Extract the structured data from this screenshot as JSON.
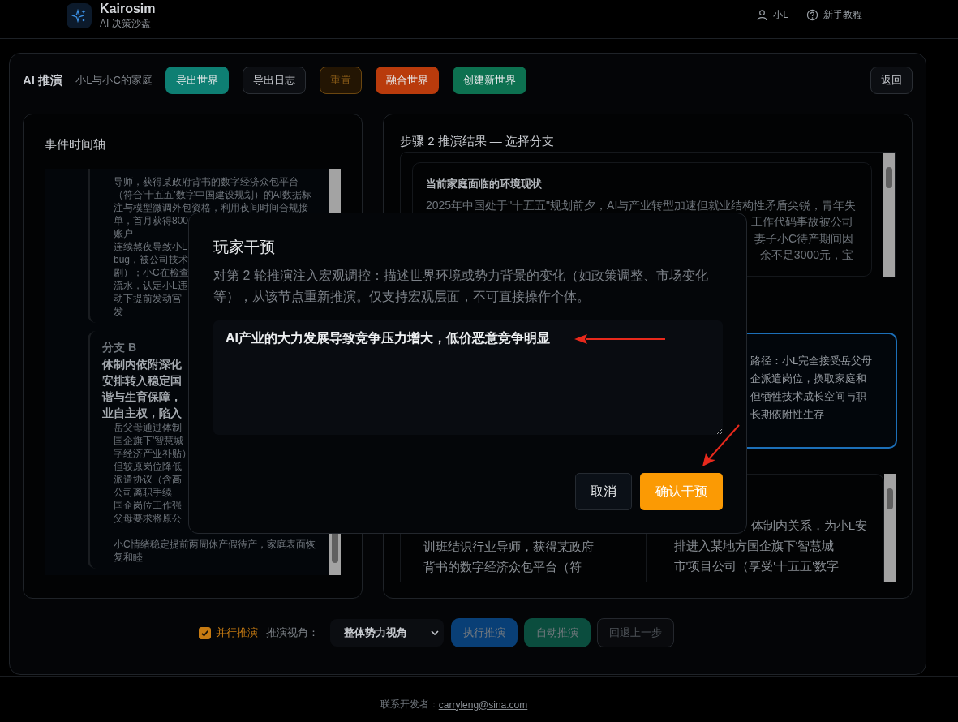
{
  "app": {
    "name": "Kairosim",
    "subtitle": "AI 决策沙盘"
  },
  "header_links": [
    {
      "kind": "user",
      "label": "小L"
    },
    {
      "kind": "help",
      "label": "新手教程"
    }
  ],
  "toolbar": {
    "title": "AI 推演",
    "world": "小L与小C的家庭",
    "buttons": [
      {
        "label": "导出世界",
        "kind": "teal"
      },
      {
        "label": "导出日志",
        "kind": "outline"
      },
      {
        "label": "重置",
        "kind": "warning"
      },
      {
        "label": "融合世界",
        "kind": "orange"
      },
      {
        "label": "创建新世界",
        "kind": "green"
      }
    ],
    "back": "返回"
  },
  "timeline": {
    "title": "事件时间轴",
    "items": [
      {
        "lines": [
          "导师，获得某政府背书的数字经济众包平台",
          "（符合'十五五'数字中国建设规划）的AI数据标",
          "注与模型微调外包资格，利用夜间时间合规接",
          "单，首月获得800",
          "账户",
          "连续熬夜导致小L",
          "bug，被公司技术",
          "剧）；小C在检查",
          "流水，认定小L违",
          "动下提前发动宫",
          "发"
        ]
      },
      {
        "label": "分支 B",
        "title_lines": [
          "体制内依附深化",
          "安排转入稳定国",
          "谐与生育保障，",
          "业自主权，陷入"
        ],
        "lines": [
          "岳父母通过体制",
          "国企旗下'智慧城",
          "字经济产业补贴）",
          "但较原岗位降低",
          "派遣协议（含高",
          "公司离职手续",
          "国企岗位工作强",
          "父母要求将原公",
          "小C情绪稳定提前两周休产假待产，家庭表面恢",
          "复和睦"
        ]
      }
    ]
  },
  "results": {
    "title": "步骤 2 推演结果 — 选择分支",
    "summary": {
      "title": "当前家庭面临的环境现状",
      "lines": [
        {
          "kind": "full",
          "text": "2025年中国处于\"十五五\"规划前夕，AI与产业转型加速但就业结构性矛盾尖锐，青年失"
        },
        {
          "kind": "tail",
          "text": "工作代码事故被公司"
        },
        {
          "kind": "tail",
          "text": "妻子小C待产期间因"
        },
        {
          "kind": "tail",
          "text": "余不足3000元，宝"
        }
      ]
    },
    "selected_branch": {
      "selected": true,
      "lines": [
        "路径：小L完全接受岳父母",
        "企派遣岗位，换取家庭和",
        "但牺牲技术成长空间与职",
        "长期依附性生存"
      ]
    },
    "branches": [
      {
        "lines": [
          {
            "kind": "full",
            "text": "训班结识行业导师，获得某政府"
          },
          {
            "kind": "full",
            "text": "背书的数字经济众包平台（符"
          }
        ]
      },
      {
        "lines": [
          {
            "kind": "tail",
            "text": "体制内关系，为小L安"
          },
          {
            "kind": "full",
            "text": "排进入某地方国企旗下'智慧城"
          },
          {
            "kind": "full",
            "text": "市'项目公司（享受'十五五'数字"
          }
        ]
      }
    ]
  },
  "controls": {
    "parallel": {
      "label": "并行推演",
      "checked": true
    },
    "view_label": "推演视角：",
    "view": "整体势力视角",
    "buttons": [
      {
        "label": "执行推演",
        "kind": "blue",
        "disabled": true
      },
      {
        "label": "自动推演",
        "kind": "green",
        "disabled": true
      },
      {
        "label": "回退上一步",
        "kind": "outline",
        "disabled": true
      }
    ]
  },
  "footer": {
    "label": "联系开发者：",
    "email": "carryleng@sina.com"
  },
  "dialog": {
    "title": "玩家干预",
    "description": "对第 2 轮推演注入宏观调控：描述世界环境或势力背景的变化（如政策调整、市场变化等），从该节点重新推演。仅支持宏观层面，不可直接操作个体。",
    "value": "AI产业的大力发展导致竞争压力增大，低价恶意竞争明显",
    "buttons": [
      {
        "label": "取消",
        "kind": "secondary"
      },
      {
        "label": "确认干预",
        "kind": "primary"
      }
    ]
  }
}
